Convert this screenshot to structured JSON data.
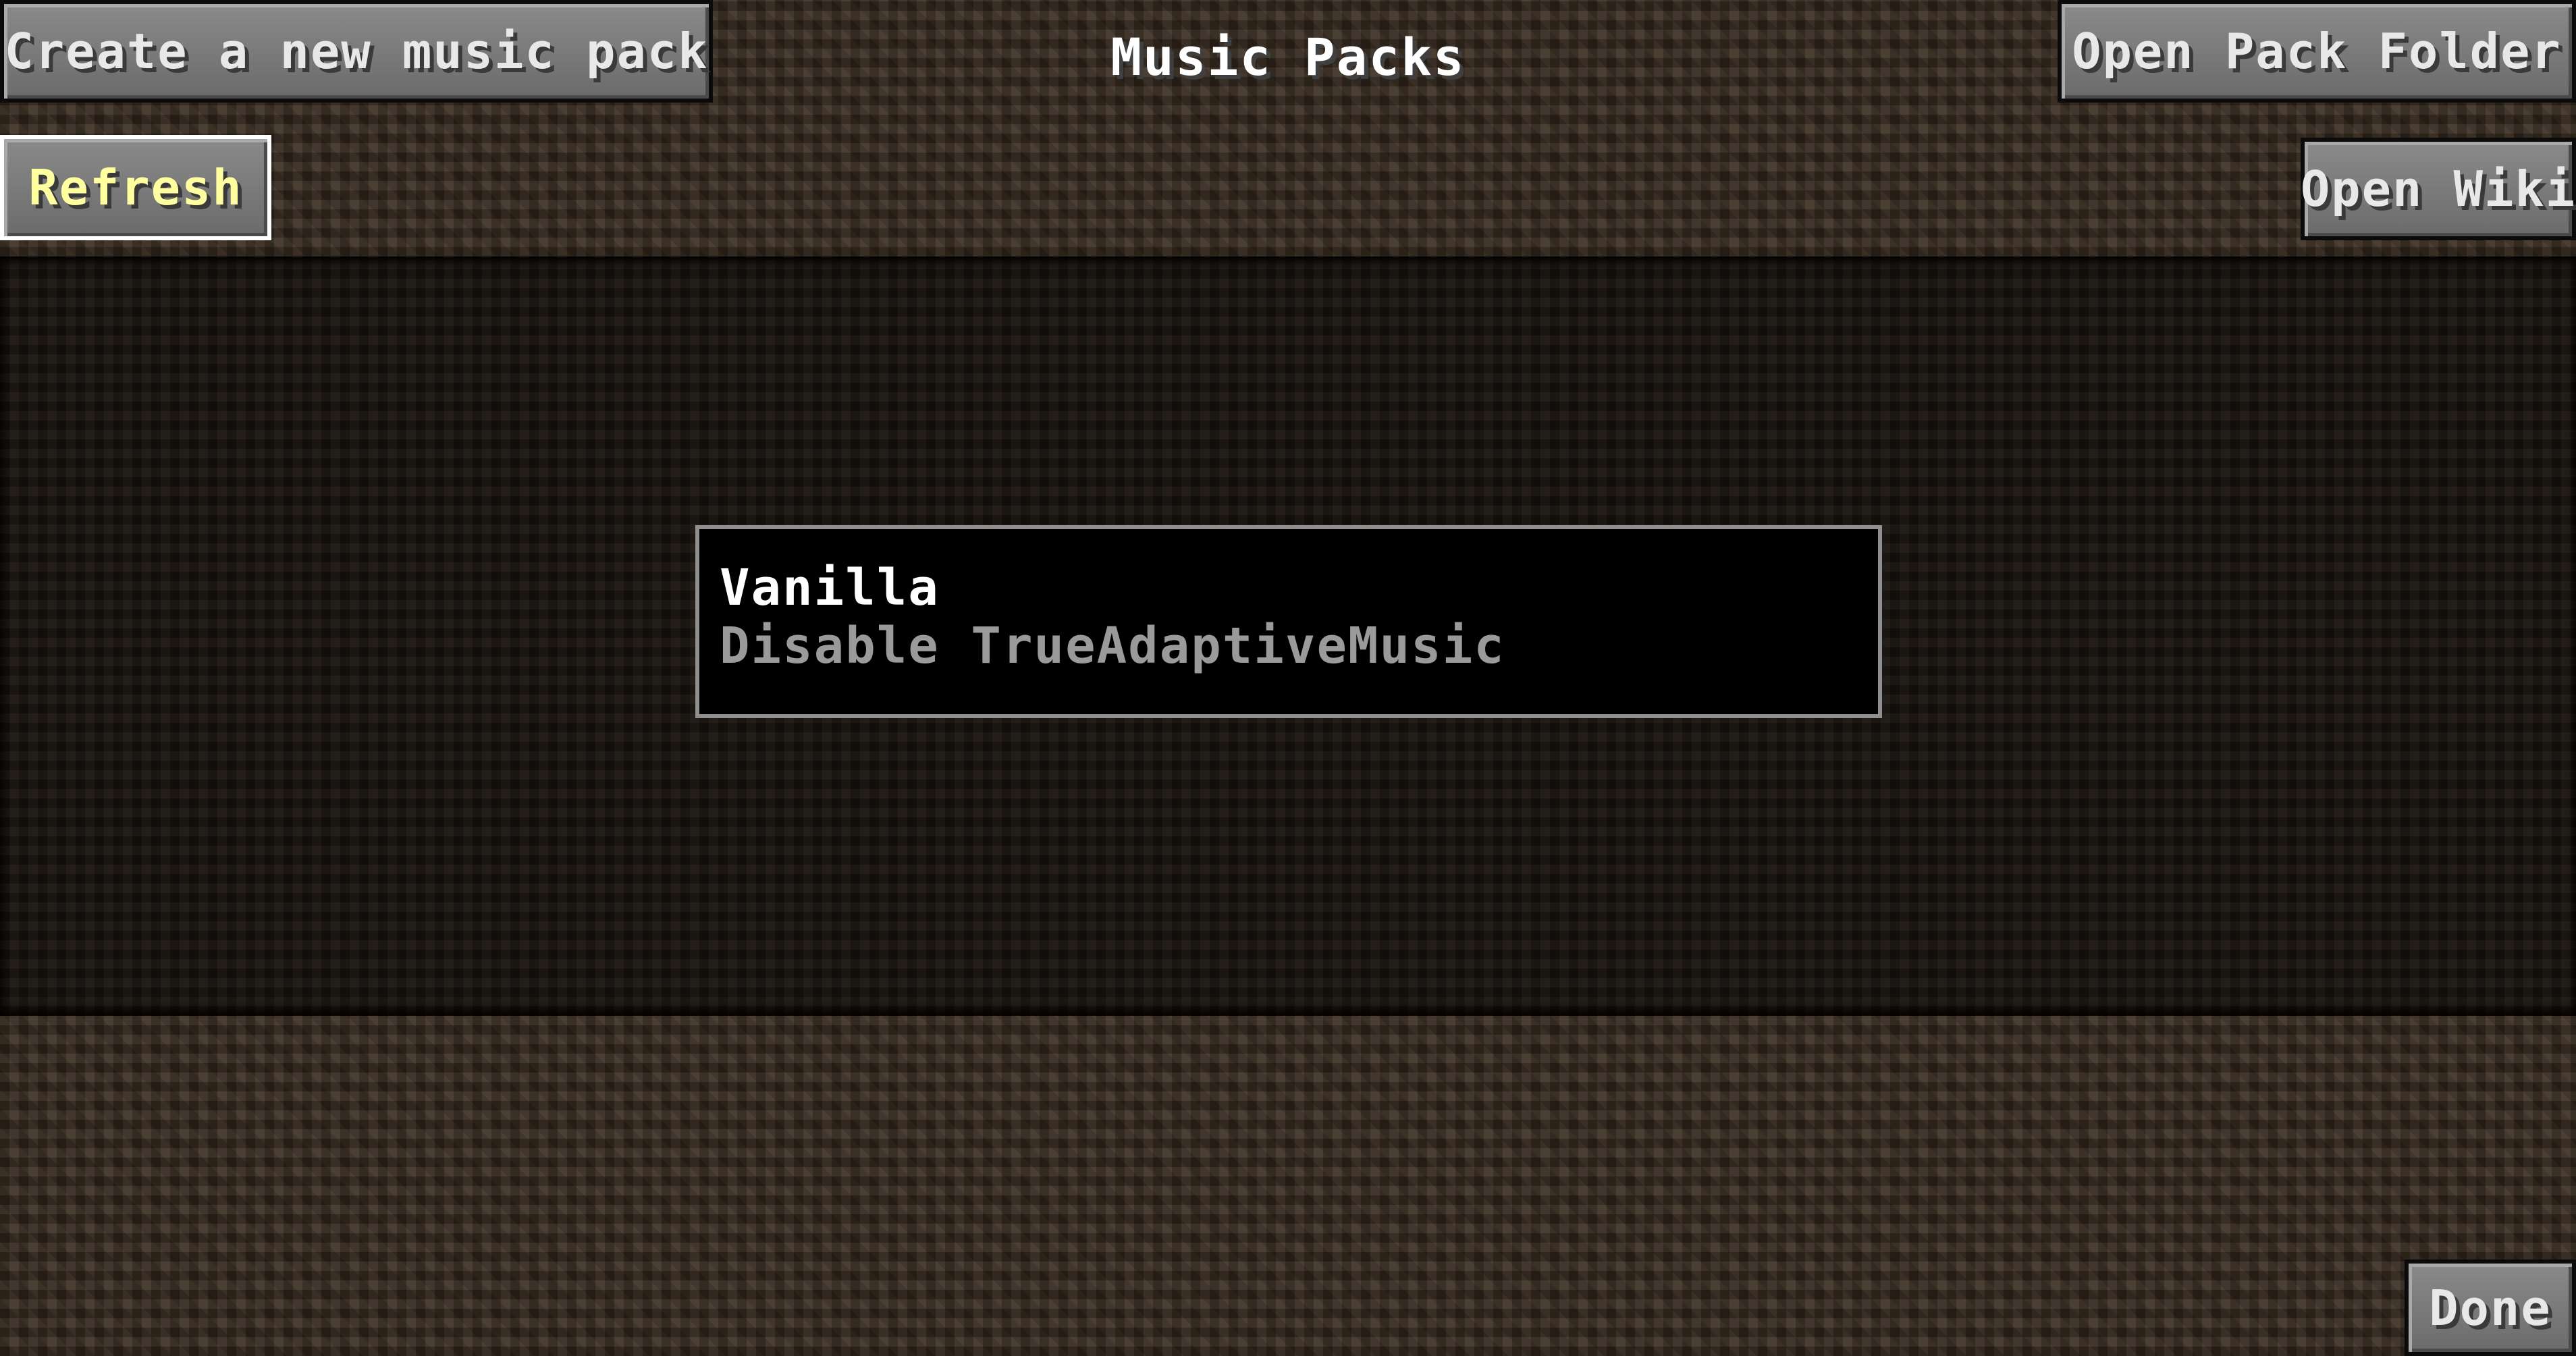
{
  "screen": {
    "title": "Music Packs"
  },
  "toolbar": {
    "create_label": "Create a new music pack",
    "refresh_label": "Refresh",
    "open_folder_label": "Open Pack Folder",
    "open_wiki_label": "Open Wiki"
  },
  "packs": [
    {
      "name": "Vanilla",
      "description": "Disable TrueAdaptiveMusic"
    }
  ],
  "footer": {
    "done_label": "Done"
  },
  "colors": {
    "button_face": "#7a7a7a",
    "hover_border": "#ffffff",
    "entry_border": "#8f8f8f",
    "description_text": "#9a9a9a"
  }
}
